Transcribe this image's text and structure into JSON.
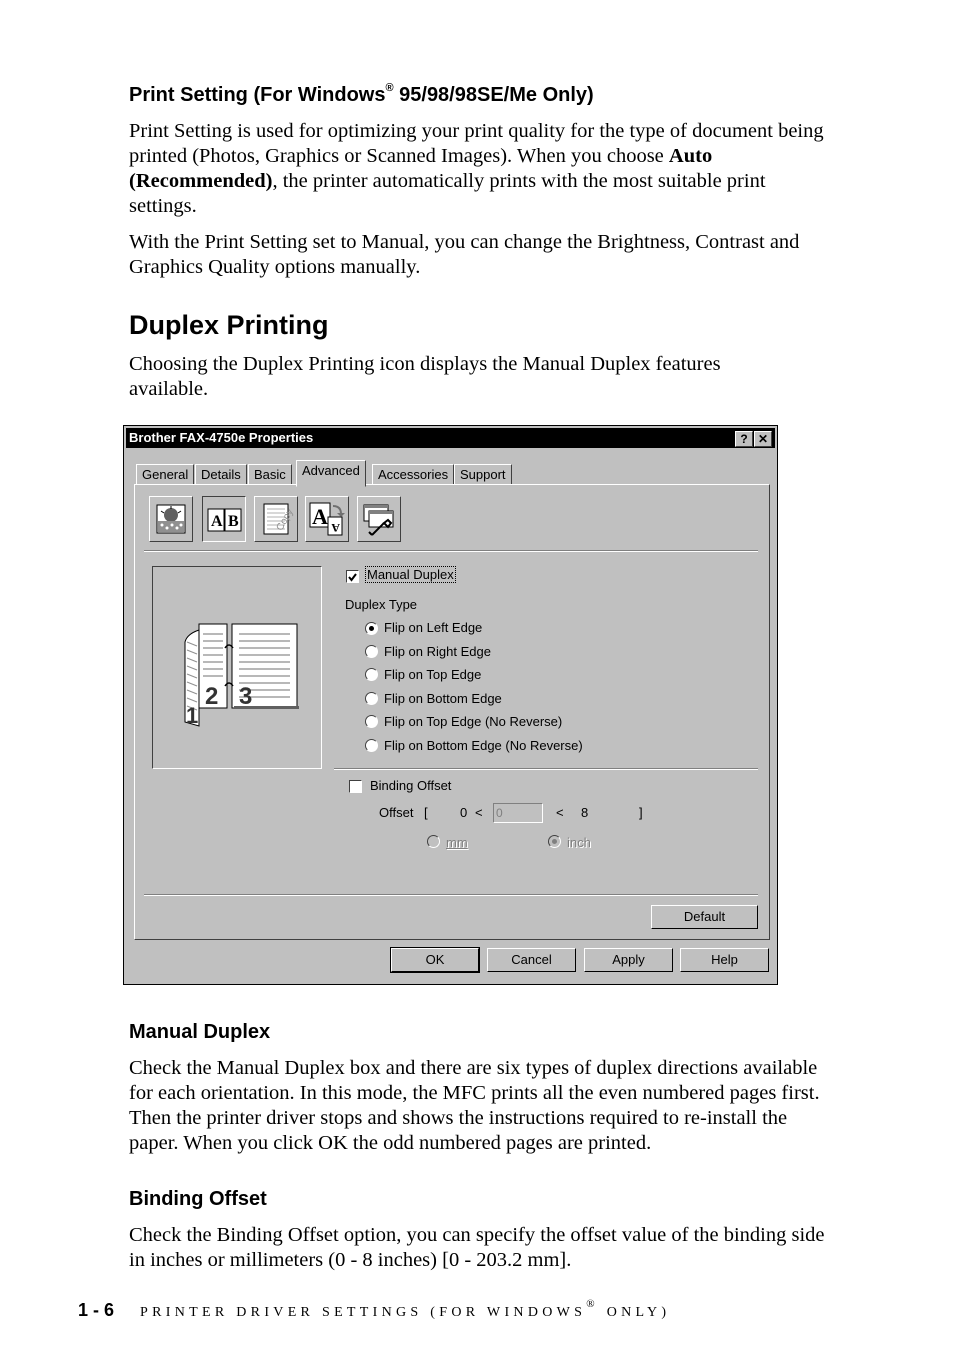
{
  "section1": {
    "heading_pre": "Print Setting (For Windows",
    "heading_reg": "®",
    "heading_post": " 95/98/98SE/Me Only)",
    "para1_a": "Print Setting is used for optimizing your print quality for the type of document being printed (Photos, Graphics or Scanned Images). When you choose ",
    "para1_bold": "Auto (Recommended)",
    "para1_b": ", the printer automatically prints with the most suitable print settings.",
    "para2": "With the Print Setting set to Manual, you can change the Brightness, Contrast and Graphics Quality options manually."
  },
  "section2": {
    "heading": "Duplex Printing",
    "para": "Choosing the Duplex Printing icon displays the Manual Duplex features available."
  },
  "dialog": {
    "title": "Brother FAX-4750e Properties",
    "help_btn": "?",
    "close_btn": "✕",
    "tabs": [
      {
        "label": "General"
      },
      {
        "label": "Details"
      },
      {
        "label": "Basic"
      },
      {
        "label": "Advanced",
        "active": true
      },
      {
        "label": "Accessories"
      },
      {
        "label": "Support"
      }
    ],
    "icon_buttons": [
      {
        "name": "print-quality-icon"
      },
      {
        "name": "duplex-printing-icon",
        "pressed": true
      },
      {
        "name": "watermark-icon",
        "glyph": "Copy"
      },
      {
        "name": "font-substitution-icon",
        "glyph_big": "A",
        "glyph_small": "A"
      },
      {
        "name": "device-options-icon"
      }
    ],
    "preview_numbers": [
      "1",
      "2",
      "3"
    ],
    "manual_duplex": {
      "label": "Manual Duplex",
      "checked": true
    },
    "duplex_type_label": "Duplex Type",
    "duplex_options": [
      {
        "label": "Flip on Left Edge",
        "selected": true
      },
      {
        "label": "Flip on Right Edge",
        "selected": false
      },
      {
        "label": "Flip on Top Edge",
        "selected": false
      },
      {
        "label": "Flip on Bottom Edge",
        "selected": false
      },
      {
        "label": "Flip on Top Edge (No Reverse)",
        "selected": false
      },
      {
        "label": "Flip on Bottom Edge (No Reverse)",
        "selected": false
      }
    ],
    "binding_offset": {
      "label": "Binding Offset",
      "checked": false
    },
    "offset": {
      "label": "Offset",
      "open_bracket": "[",
      "min": "0",
      "lt1": "<",
      "value": "0",
      "lt2": "<",
      "max": "8",
      "close_bracket": "]"
    },
    "units": [
      {
        "label": "mm",
        "selected": false
      },
      {
        "label": "inch",
        "selected": true
      }
    ],
    "default_btn": "Default",
    "ok_btn": "OK",
    "cancel_btn": "Cancel",
    "apply_btn": "Apply",
    "help_btn2": "Help"
  },
  "section3": {
    "heading": "Manual Duplex",
    "para": "Check the Manual Duplex box and there are six types of duplex directions available for each orientation.  In this mode, the MFC prints all the even numbered pages first. Then the printer driver stops and shows the instructions required to re-install the paper. When you click OK the odd numbered pages are printed."
  },
  "section4": {
    "heading": "Binding Offset",
    "para": "Check the Binding Offset option, you can specify the offset value of the binding side in inches or millimeters (0 - 8 inches) [0 - 203.2 mm]."
  },
  "footer": {
    "page": "1 - 6",
    "running_pre": "PRINTER DRIVER SETTINGS (FOR WINDOWS",
    "running_reg": "®",
    "running_post": " ONLY)"
  }
}
